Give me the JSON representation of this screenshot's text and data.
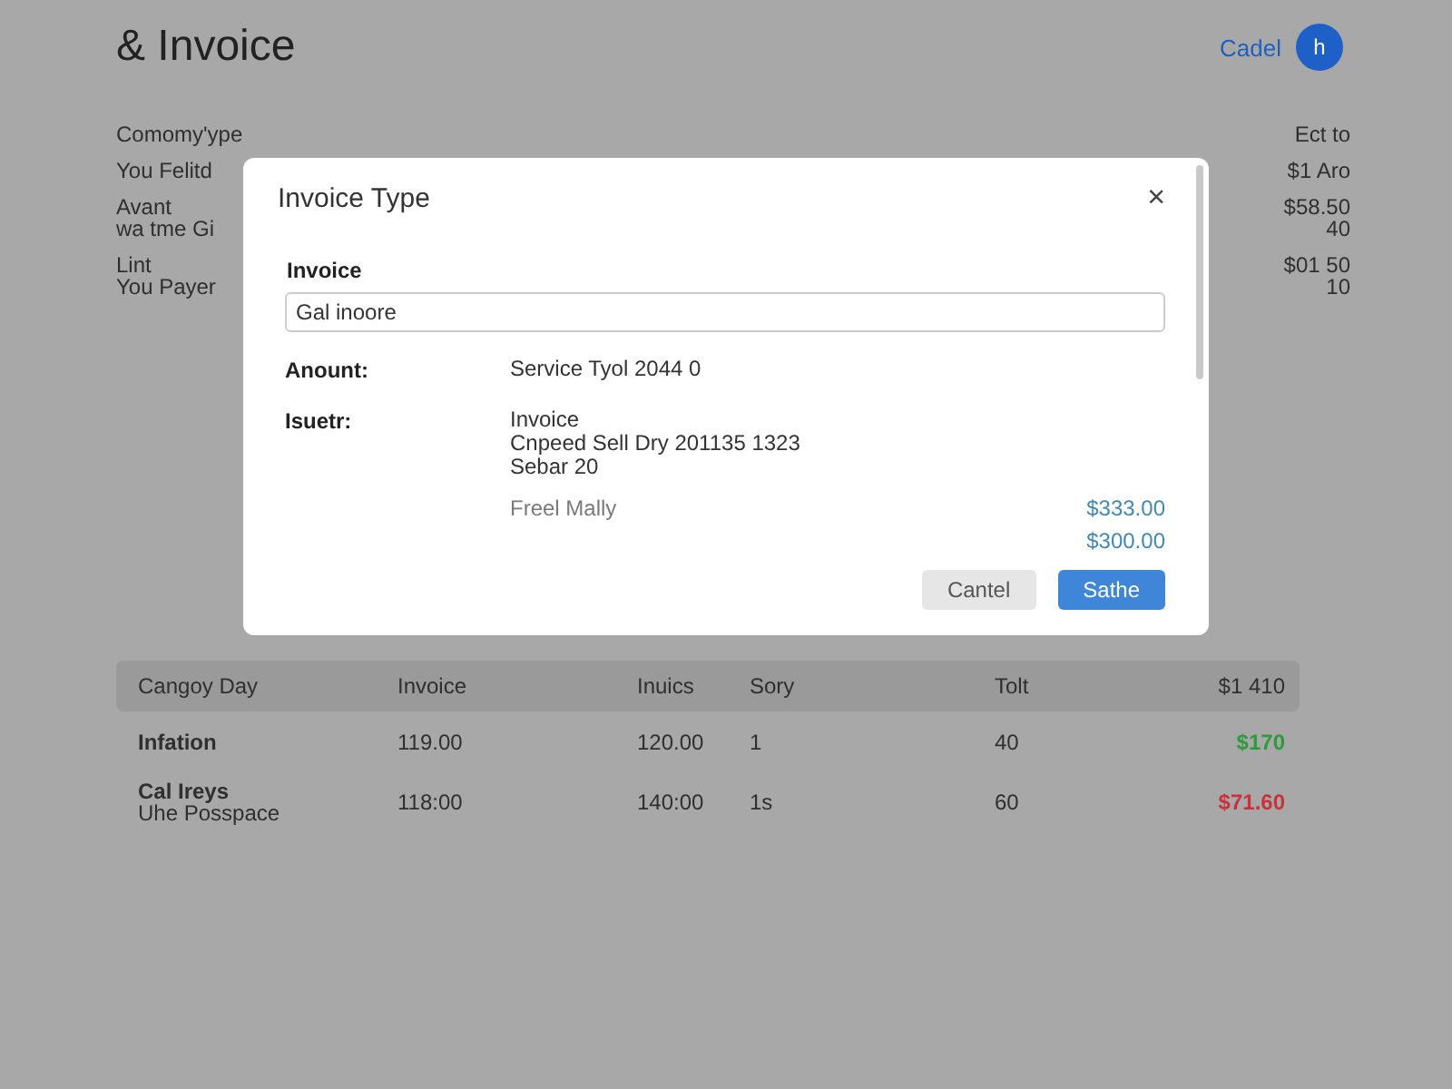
{
  "header": {
    "title": "& Invoice",
    "link": "Cadel",
    "avatar": "h"
  },
  "info": {
    "left": [
      {
        "lines": [
          "Comomy'ype"
        ]
      },
      {
        "lines": [
          "You Felitd"
        ]
      },
      {
        "lines": [
          "Avant",
          "wa tme Gi"
        ]
      },
      {
        "lines": [
          "Lint",
          "You Payer"
        ]
      }
    ],
    "right": [
      {
        "lines": [
          "Ect to"
        ]
      },
      {
        "lines": [
          "$1 Aro"
        ]
      },
      {
        "lines": [
          "$58.50",
          "40"
        ]
      },
      {
        "lines": [
          "$01 50",
          "10"
        ]
      }
    ]
  },
  "table": {
    "columns": [
      "Cangoy Day",
      "Invoice",
      "Inuics",
      "Sory",
      "Tolt",
      "$1 410"
    ],
    "rows": [
      {
        "cells": [
          "Infation",
          "119.00",
          "120.00",
          "1",
          "40"
        ],
        "amount": "$170",
        "color": "#2e9a3e"
      },
      {
        "cells": [
          "Cal Ireys",
          "118:00",
          "140:00",
          "1s",
          "60"
        ],
        "sub": "Uhe Posspace",
        "amount": "$71.60",
        "color": "#c8323a"
      }
    ]
  },
  "dialog": {
    "title": "Invoice Type",
    "close": "×",
    "field_label": "Invoice",
    "field_value": "Gal inoore",
    "details": [
      {
        "label": "Anount:",
        "lines": [
          "Service Tyol 2044 0"
        ]
      },
      {
        "label": "Isuetr:",
        "lines": [
          "Invoice",
          "Cnpeed Sell Dry 201135 1323",
          "Sebar 20"
        ]
      }
    ],
    "summary": [
      {
        "label": "Freel Mally",
        "amount": "$333.00"
      },
      {
        "amount": "$300.00"
      }
    ],
    "buttons": [
      {
        "label": "Cantel",
        "kind": "secondary"
      },
      {
        "label": "Sathe",
        "kind": "primary"
      }
    ]
  }
}
